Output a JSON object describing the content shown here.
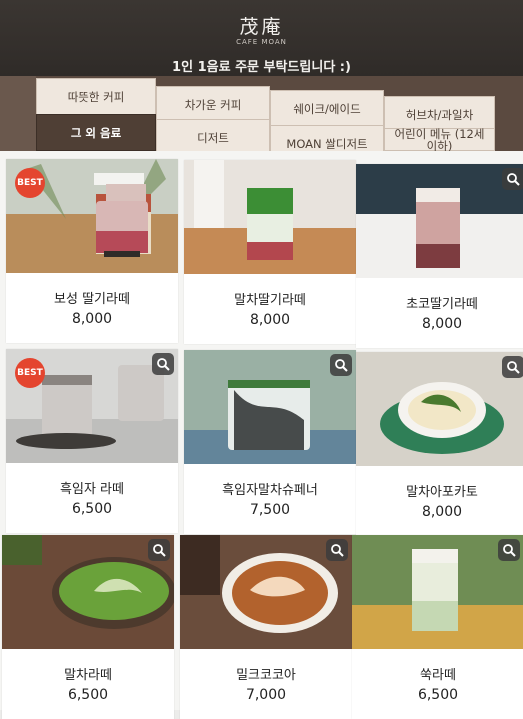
{
  "header": {
    "logo": "茂庵",
    "logo_sub": "CAFE MOAN",
    "notice": "1인 1음료 주문 부탁드립니다 :)"
  },
  "tabs": {
    "row1": [
      "따뜻한 커피",
      "차가운 커피",
      "쉐이크/에이드",
      "허브차/과일차"
    ],
    "row2": [
      "그 외 음료",
      "디저트",
      "MOAN 쌀디저트",
      "어린이 메뉴 (12세 이하)"
    ],
    "active": "그 외 음료"
  },
  "badge_label": "BEST",
  "products": [
    {
      "name": "보성 딸기라떼",
      "price": "8,000",
      "best": true
    },
    {
      "name": "말차딸기라떼",
      "price": "8,000",
      "best": false
    },
    {
      "name": "초코딸기라떼",
      "price": "8,000",
      "best": false
    },
    {
      "name": "흑임자 라떼",
      "price": "6,500",
      "best": true
    },
    {
      "name": "흑임자말차슈페너",
      "price": "7,500",
      "best": false
    },
    {
      "name": "말차아포카토",
      "price": "8,000",
      "best": false
    },
    {
      "name": "말차라떼",
      "price": "6,500",
      "best": false
    },
    {
      "name": "밀크코코아",
      "price": "7,000",
      "best": false
    },
    {
      "name": "쑥라떼",
      "price": "6,500",
      "best": false
    }
  ],
  "colors": {
    "header_bg": "#2f2b28",
    "tab_active": "#4f3f35",
    "tab_inactive": "#efe7de",
    "best_badge": "#e4452f"
  },
  "icons": [
    "magnifier-icon"
  ]
}
